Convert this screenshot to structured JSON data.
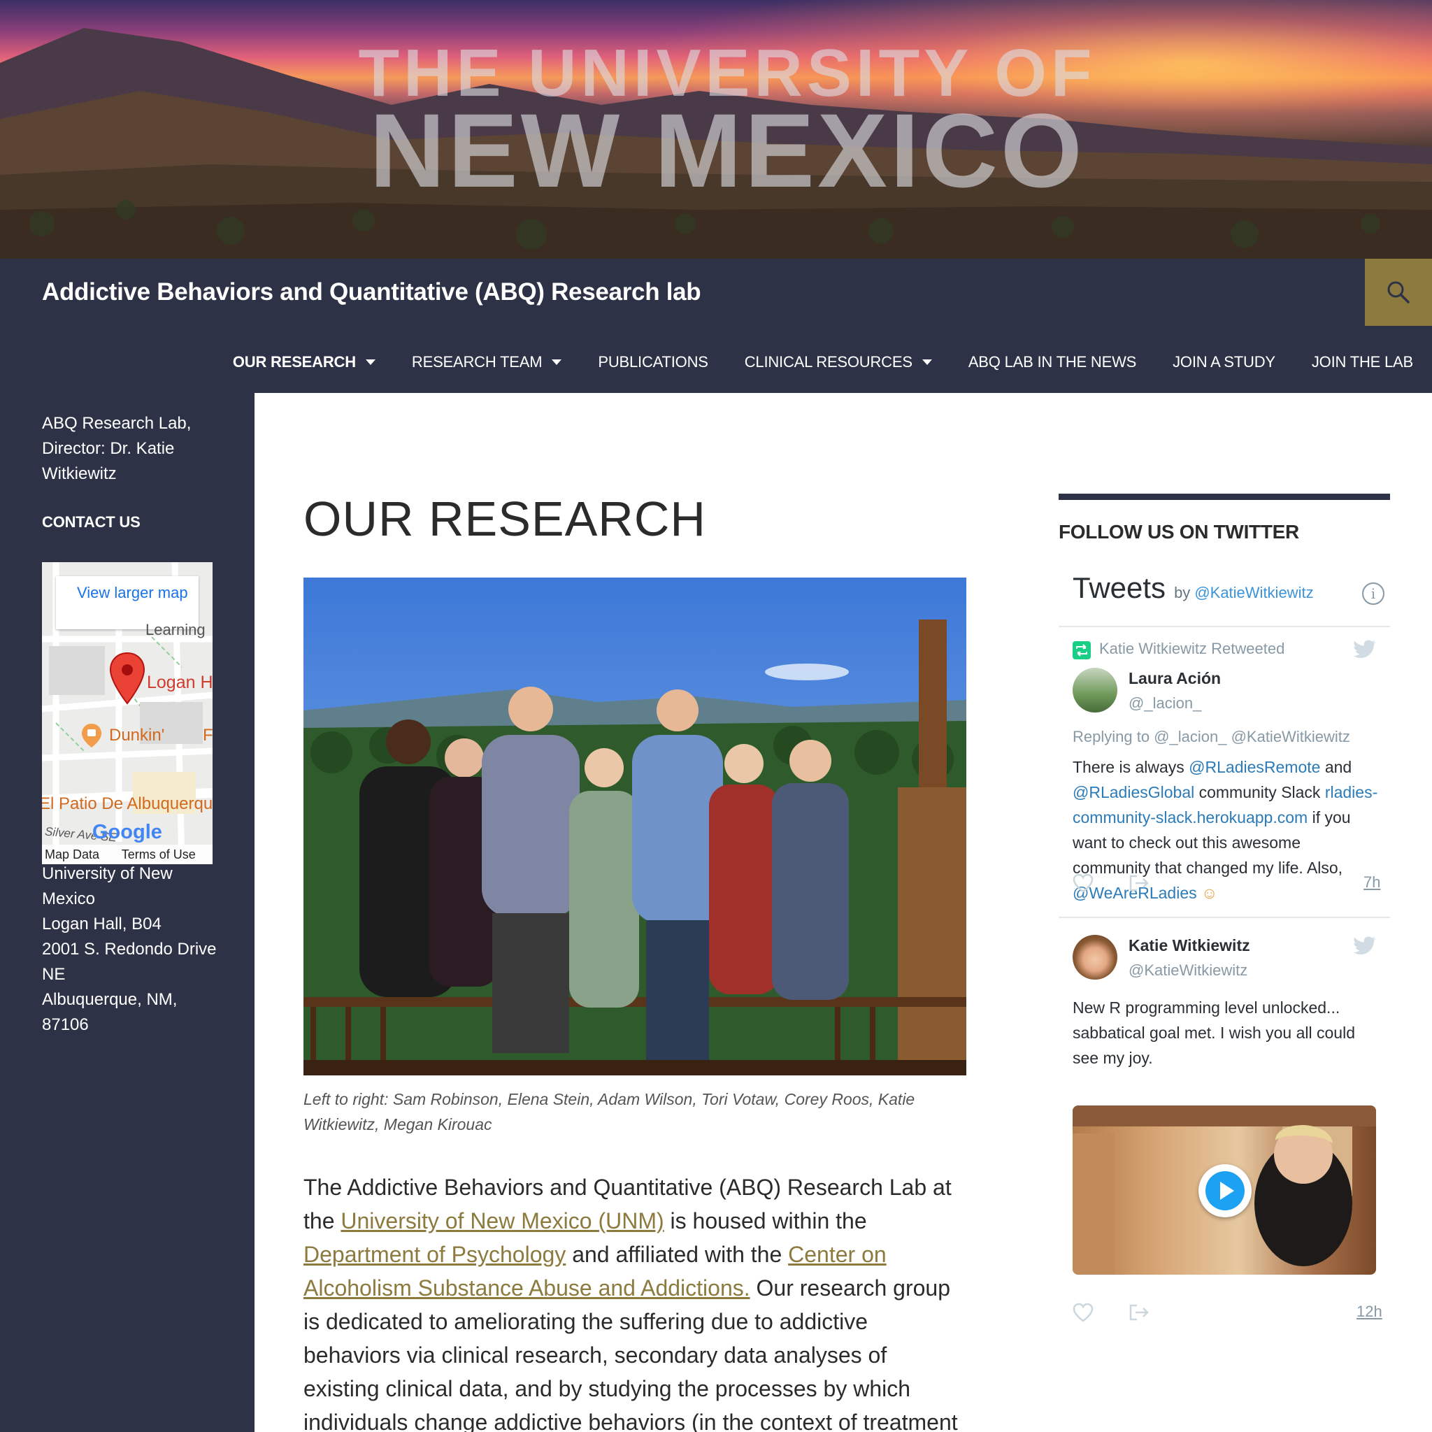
{
  "banner": {
    "line1": "THE UNIVERSITY OF",
    "line2": "NEW MEXICO"
  },
  "header": {
    "site_title": "Addictive Behaviors and Quantitative (ABQ) Research lab",
    "search_icon": "search-icon"
  },
  "nav": {
    "items": [
      {
        "label": "OUR RESEARCH",
        "has_caret": true,
        "active": true
      },
      {
        "label": "RESEARCH TEAM",
        "has_caret": true
      },
      {
        "label": "PUBLICATIONS",
        "has_caret": false
      },
      {
        "label": "CLINICAL RESOURCES",
        "has_caret": true
      },
      {
        "label": "ABQ LAB IN THE NEWS",
        "has_caret": false
      },
      {
        "label": "JOIN A STUDY",
        "has_caret": false
      },
      {
        "label": "JOIN THE LAB",
        "has_caret": false
      }
    ]
  },
  "sidebar": {
    "tagline": "ABQ Research Lab, Director: Dr. Katie Witkiewitz",
    "contact_heading": "CONTACT US",
    "map": {
      "view_larger": "View larger map",
      "labels": [
        "Logan H",
        "Dunkin'",
        "El Patio De Albuquerque",
        "Silver Ave SE",
        "Learning",
        "F"
      ],
      "logo": "Google",
      "map_data": "Map Data",
      "terms": "Terms of Use"
    },
    "address": [
      "University of New Mexico",
      "Logan Hall, B04",
      "2001 S. Redondo Drive NE",
      "Albuquerque, NM, 87106"
    ]
  },
  "main": {
    "page_title": "OUR RESEARCH",
    "photo_caption": "Left to right: Sam Robinson, Elena Stein, Adam Wilson, Tori Votaw, Corey Roos, Katie Witkiewitz, Megan Kirouac",
    "body": {
      "p1_a": "The Addictive Behaviors and Quantitative (ABQ) Research Lab at the ",
      "link_unm": "University of New Mexico (UNM)",
      "p1_b": " is housed within the ",
      "link_psych": "Department of Psychology",
      "p1_c": " and affiliated with the ",
      "link_casaa": "Center on Alcoholism Substance Abuse and Addictions.",
      "p1_d": " Our research group is dedicated to ameliorating the suffering due to addictive behaviors via clinical research, secondary data analyses of existing clinical data, and by studying the processes by which individuals change addictive behaviors (in the context of treatment and outside of treatment). We are"
    }
  },
  "twitter": {
    "heading": "FOLLOW US ON TWITTER",
    "widget_title": "Tweets",
    "by": "by",
    "handle": "@KatieWitkiewitz",
    "tweet1": {
      "retweet_label": "Katie Witkiewitz Retweeted",
      "name": "Laura Ación",
      "user": "@_lacion_",
      "replying": "Replying to @_lacion_ @KatieWitkiewitz",
      "t1": "There is always ",
      "m1": "@RLadiesRemote",
      "t2": " and ",
      "m2": "@RLadiesGlobal",
      "t3": " community Slack ",
      "url": "rladies-community-slack.herokuapp.com",
      "t4": " if you want to check out this awesome community that changed my life. Also, ",
      "m3": "@WeAreRLadies",
      "emoji": "☺",
      "time": "7h"
    },
    "tweet2": {
      "name": "Katie Witkiewitz",
      "user": "@KatieWitkiewitz",
      "text": "New R programming level unlocked... sabbatical goal met.  I wish you all could see my joy.",
      "time": "12h"
    }
  }
}
